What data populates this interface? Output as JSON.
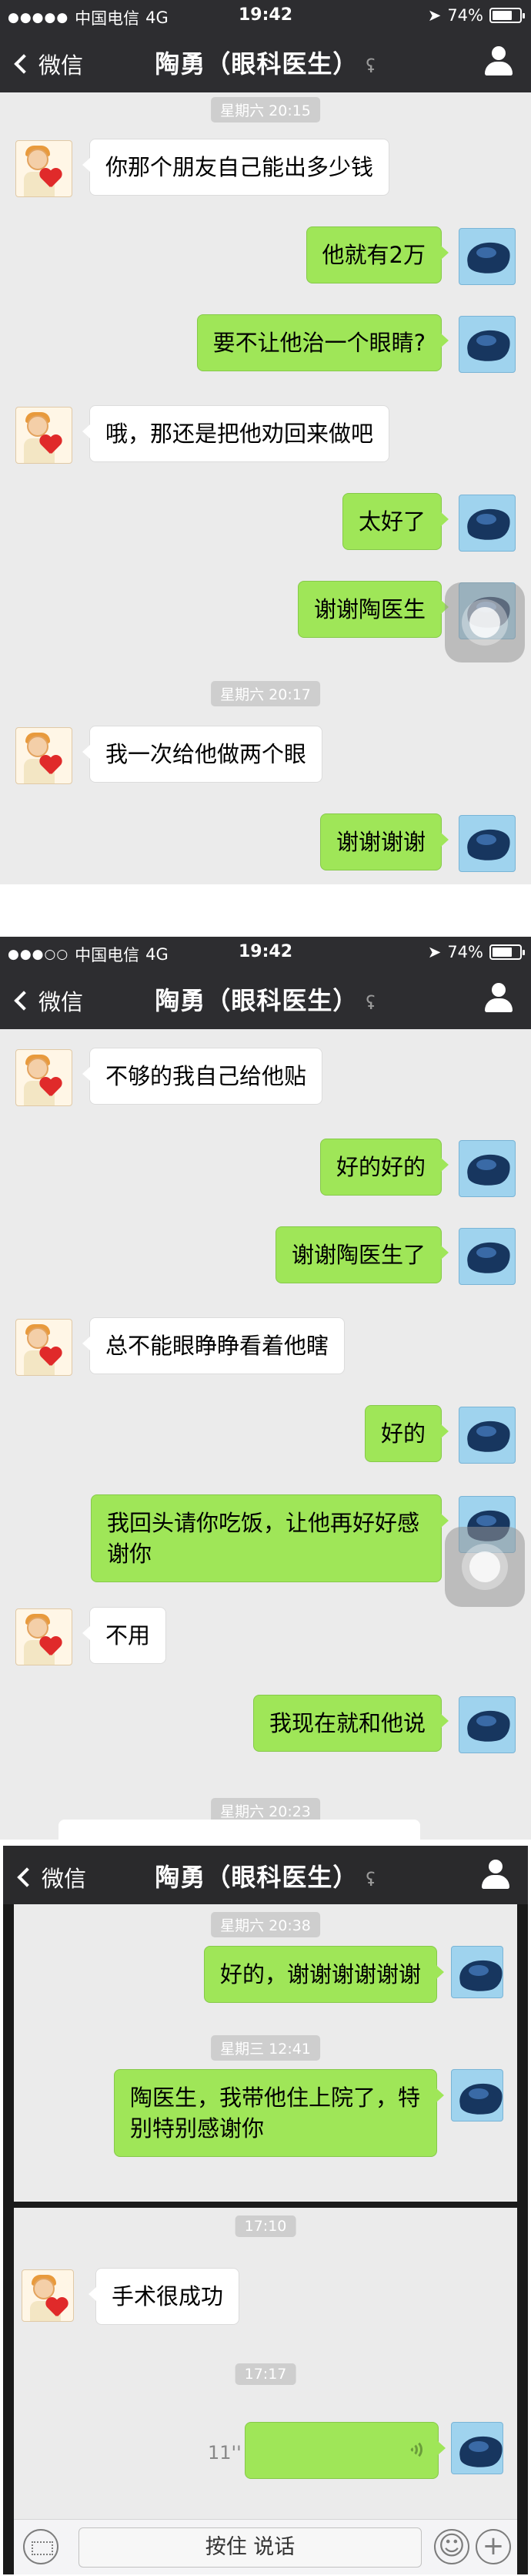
{
  "status": {
    "carrier": "中国电信",
    "network": "4G",
    "time": "19:42",
    "battery": "74%",
    "battery_level": 0.74
  },
  "nav": {
    "back_label": "微信",
    "title": "陶勇（眼科医生）"
  },
  "shot1": {
    "time_pill_1": "星期六 20:15",
    "time_pill_2": "星期六 20:17",
    "messages": [
      {
        "side": "left",
        "text": "你那个朋友自己能出多少钱"
      },
      {
        "side": "right",
        "text": "他就有2万"
      },
      {
        "side": "right",
        "text": "要不让他治一个眼睛?"
      },
      {
        "side": "left",
        "text": "哦，那还是把他劝回来做吧"
      },
      {
        "side": "right",
        "text": "太好了"
      },
      {
        "side": "right",
        "text": "谢谢陶医生"
      },
      {
        "side": "left",
        "text": "我一次给他做两个眼"
      },
      {
        "side": "right",
        "text": "谢谢谢谢"
      }
    ]
  },
  "shot2": {
    "time_pill_cut": "星期六 20:23",
    "messages": [
      {
        "side": "left",
        "text": "不够的我自己给他贴"
      },
      {
        "side": "right",
        "text": "好的好的"
      },
      {
        "side": "right",
        "text": "谢谢陶医生了"
      },
      {
        "side": "left",
        "text": "总不能眼睁睁看着他瞎"
      },
      {
        "side": "right",
        "text": "好的"
      },
      {
        "side": "right",
        "text": "我回头请你吃饭，让他再好好感谢你"
      },
      {
        "side": "left",
        "text": "不用"
      },
      {
        "side": "right",
        "text": "我现在就和他说"
      }
    ]
  },
  "shot3": {
    "time_pill_1": "星期六 20:38",
    "time_pill_2": "星期三 12:41",
    "time_pill_3": "17:10",
    "time_pill_4": "17:17",
    "messages": [
      {
        "side": "right",
        "text": "好的，谢谢谢谢谢谢"
      },
      {
        "side": "right",
        "text": "陶医生，我带他住上院了，特别特别感谢你"
      },
      {
        "side": "left",
        "text": "手术很成功"
      }
    ],
    "voice_duration": "11''",
    "hold_to_talk": "按住 说话"
  }
}
